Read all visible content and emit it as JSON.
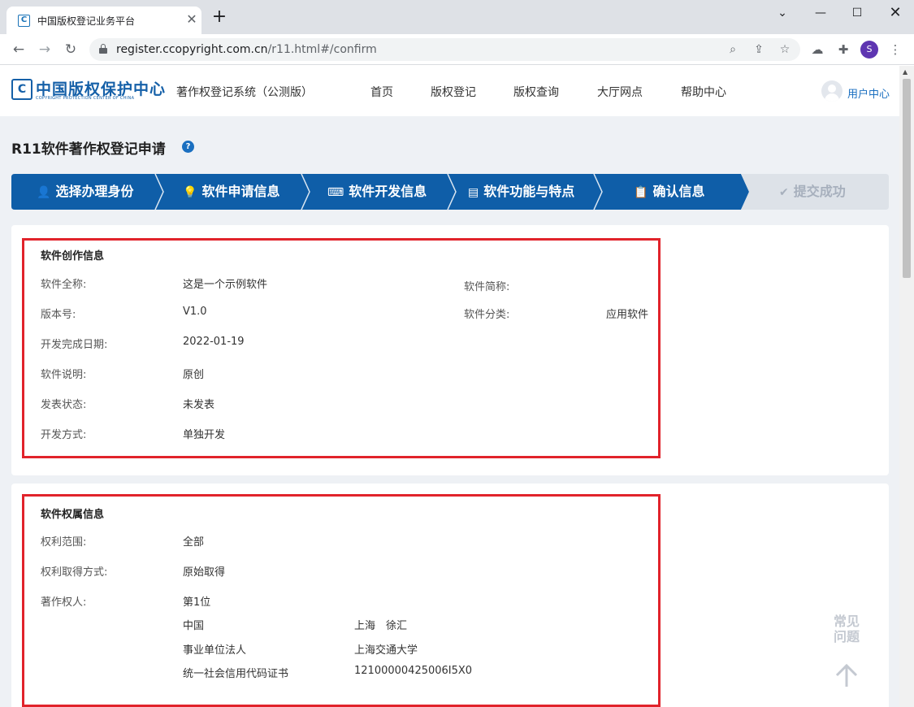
{
  "browser": {
    "tab_title": "中国版权登记业务平台",
    "tab_favicon": "C",
    "url_host": "register.ccopyright.com.cn",
    "url_path": "/r11.html#/confirm",
    "profile_initial": "S",
    "icons": [
      "back-icon",
      "forward-icon",
      "reload-icon",
      "lock-icon",
      "zoom-icon",
      "share-icon",
      "bookmark-star-icon",
      "extension-icon",
      "puzzle-icon",
      "menu-dots-icon"
    ]
  },
  "header": {
    "logo_name": "中国版权保护中心",
    "logo_mark": "C",
    "logo_en": "COPYRIGHT PROTECTION CENTER OF CHINA",
    "system_name": "著作权登记系统（公测版）",
    "nav": [
      "首页",
      "版权登记",
      "版权查询",
      "大厅网点",
      "帮助中心"
    ],
    "user_center": "用户中心"
  },
  "page": {
    "title": "R11软件著作权登记申请",
    "help_icon": "?"
  },
  "steps": [
    {
      "label": "选择办理身份",
      "icon": "user-icon",
      "status": "active"
    },
    {
      "label": "软件申请信息",
      "icon": "bulb-icon",
      "status": "active"
    },
    {
      "label": "软件开发信息",
      "icon": "code-window-icon",
      "status": "active"
    },
    {
      "label": "软件功能与特点",
      "icon": "document-icon",
      "status": "active"
    },
    {
      "label": "确认信息",
      "icon": "clipboard-icon",
      "status": "active"
    },
    {
      "label": "提交成功",
      "icon": "check-circle-icon",
      "status": "pending"
    }
  ],
  "creation": {
    "title": "软件创作信息",
    "full_name_label": "软件全称:",
    "full_name_value": "这是一个示例软件",
    "short_name_label": "软件简称:",
    "short_name_value": "",
    "version_label": "版本号:",
    "version_value": "V1.0",
    "category_label": "软件分类:",
    "category_value": "应用软件",
    "date_label": "开发完成日期:",
    "date_value": "2022-01-19",
    "desc_label": "软件说明:",
    "desc_value": "原创",
    "publish_label": "发表状态:",
    "publish_value": "未发表",
    "dev_mode_label": "开发方式:",
    "dev_mode_value": "单独开发"
  },
  "ownership": {
    "title": "软件权属信息",
    "scope_label": "权利范围:",
    "scope_value": "全部",
    "acquire_label": "权利取得方式:",
    "acquire_value": "原始取得",
    "owner_label": "著作权人:",
    "owner_rank": "第1位",
    "owner_country": "中国",
    "owner_region": "上海　徐汇",
    "owner_type": "事业单位法人",
    "owner_name": "上海交通大学",
    "owner_cert_type": "统一社会信用代码证书",
    "owner_cert_no": "12100000425006I5X0"
  },
  "float": {
    "faq_line1": "常见",
    "faq_line2": "问题"
  }
}
